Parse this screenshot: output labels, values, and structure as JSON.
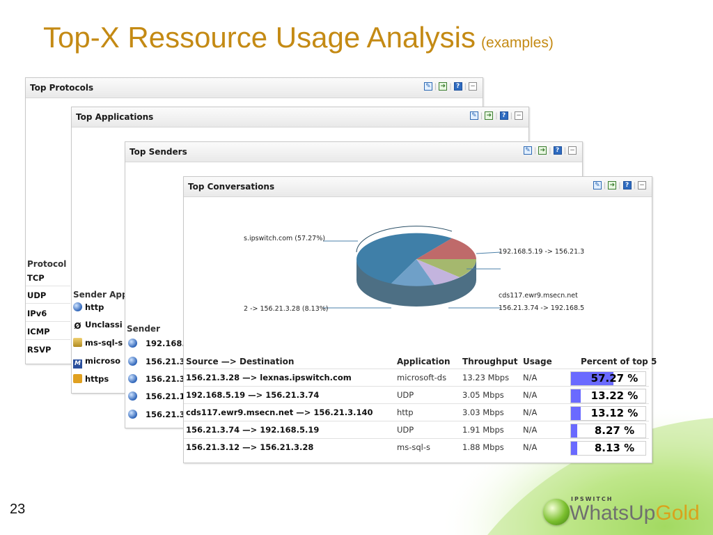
{
  "slide": {
    "title": "Top-X Ressource Usage Analysis",
    "subtitle": "(examples)",
    "page_number": "23"
  },
  "logo": {
    "top_text": "IPSWITCH",
    "word_main": "WhatsUp",
    "word_accent": "Gold"
  },
  "widgets": {
    "protocols": {
      "title": "Top Protocols",
      "column": "Protocol",
      "items": [
        "TCP",
        "UDP",
        "IPv6",
        "ICMP",
        "RSVP"
      ]
    },
    "applications": {
      "title": "Top Applications",
      "column": "Sender App",
      "items": [
        {
          "label": "http",
          "icon": "globe-icon"
        },
        {
          "label": "Unclassi",
          "icon": "null-icon"
        },
        {
          "label": "ms-sql-s",
          "icon": "database-key-icon"
        },
        {
          "label": "microso",
          "icon": "ms-app-icon"
        },
        {
          "label": "https",
          "icon": "lock-icon"
        }
      ]
    },
    "senders": {
      "title": "Top Senders",
      "column": "Sender",
      "items": [
        "192.168.",
        "156.21.3.",
        "156.21.3.",
        "156.21.1.",
        "156.21.3."
      ]
    },
    "conversations": {
      "title": "Top Conversations",
      "pie_labels": {
        "top_left": "s.ipswitch.com (57.27%)",
        "top_right": "192.168.5.19 -> 156.21.3",
        "mid_right": "cds117.ewr9.msecn.net",
        "bottom_left": "2 -> 156.21.3.28 (8.13%)",
        "bottom_right": "156.21.3.74 -> 192.168.5"
      },
      "columns": [
        "Source —> Destination",
        "Application",
        "Throughput",
        "Usage",
        "Percent of top 5"
      ],
      "rows": [
        {
          "conversation": "156.21.3.28 —> lexnas.ipswitch.com",
          "application": "microsoft-ds",
          "throughput": "13.23 Mbps",
          "usage": "N/A",
          "percent": 57.27,
          "percent_label": "57.27 %"
        },
        {
          "conversation": "192.168.5.19 —> 156.21.3.74",
          "application": "UDP",
          "throughput": "3.05 Mbps",
          "usage": "N/A",
          "percent": 13.22,
          "percent_label": "13.22 %"
        },
        {
          "conversation": "cds117.ewr9.msecn.net —> 156.21.3.140",
          "application": "http",
          "throughput": "3.03 Mbps",
          "usage": "N/A",
          "percent": 13.12,
          "percent_label": "13.12 %"
        },
        {
          "conversation": "156.21.3.74 —> 192.168.5.19",
          "application": "UDP",
          "throughput": "1.91 Mbps",
          "usage": "N/A",
          "percent": 8.27,
          "percent_label": "8.27 %"
        },
        {
          "conversation": "156.21.3.12 —> 156.21.3.28",
          "application": "ms-sql-s",
          "throughput": "1.88 Mbps",
          "usage": "N/A",
          "percent": 8.13,
          "percent_label": "8.13 %"
        }
      ]
    }
  },
  "colors": {
    "title": "#c48a14",
    "bar_fill": "#6a6aff",
    "pie_colors": [
      "#3f7fa8",
      "#c06060",
      "#8fa855",
      "#b8a8d8",
      "#6a9ac0"
    ]
  }
}
